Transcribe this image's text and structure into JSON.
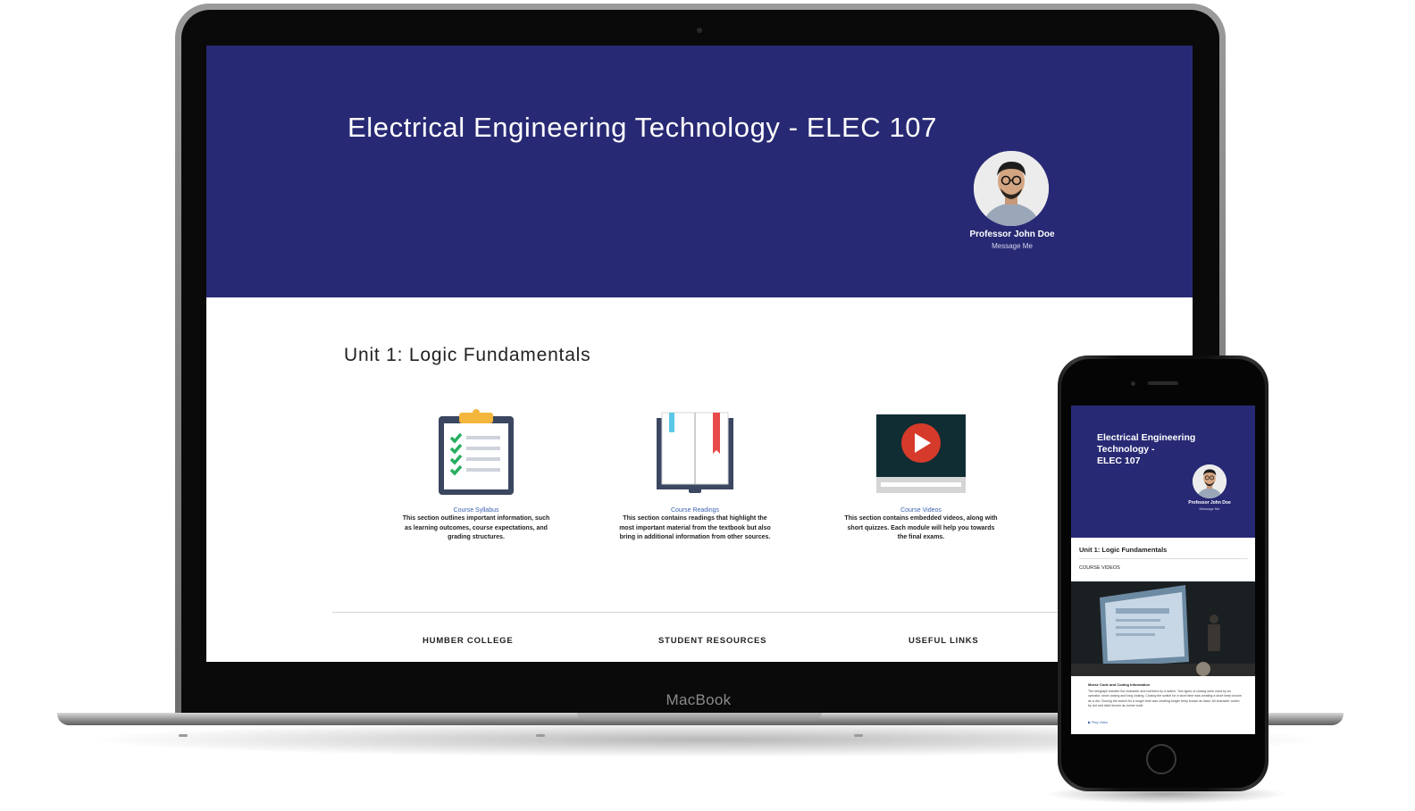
{
  "laptop": {
    "brand_label": "MacBook",
    "hero": {
      "title": "Electrical Engineering Technology - ELEC 107",
      "professor_name": "Professor John Doe",
      "message_link": "Message Me",
      "bg_color": "#282974"
    },
    "unit_title": "Unit 1: Logic Fundamentals",
    "cards": [
      {
        "title": "Course Syllabus",
        "description": "This section outlines important information, such as learning outcomes, course expectations, and grading structures.",
        "icon": "clipboard-checklist-icon"
      },
      {
        "title": "Course Readings",
        "description": "This section contains readings that highlight the most important material from the textbook but also bring in additional information from other sources.",
        "icon": "open-book-icon"
      },
      {
        "title": "Course Videos",
        "description": "This section contains embedded videos, along with short quizzes. Each module will help you towards the final exams.",
        "icon": "video-player-icon"
      }
    ],
    "footer_links": [
      "HUMBER COLLEGE",
      "STUDENT RESOURCES",
      "USEFUL LINKS"
    ]
  },
  "phone": {
    "hero": {
      "title_line1": "Electrical Engineering",
      "title_line2": "Technology -",
      "title_line3": "ELEC 107",
      "professor_name": "Professor John Doe",
      "message_link": "Message Me"
    },
    "unit_title": "Unit 1: Logic Fundamentals",
    "section_label": "COURSE VIDEOS",
    "video_card": {
      "title": "Morse Code and Coding Information",
      "text": "The telegraph transfer the character and numbers by a switch. Two types of closing were used by an operator, short closing and long closing. Closing the switch for a short time was creating a short beep known as a dot. Closing the switch for a longer time was creating longer beep known as dash. All character coded by dot and dash known as morse code",
      "play_link": "▶ Play Video"
    }
  },
  "colors": {
    "accent": "#282974",
    "link": "#3d64b0",
    "play_red": "#d63a2a"
  }
}
